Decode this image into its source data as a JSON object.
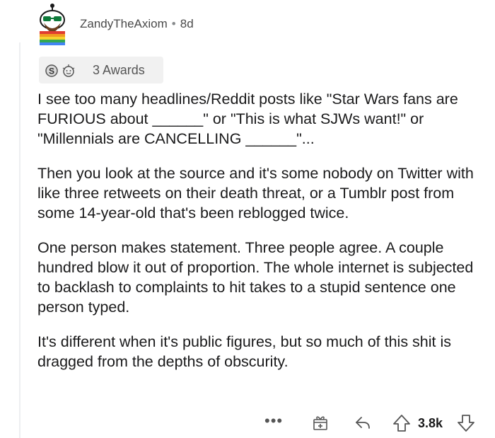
{
  "comment": {
    "author": "ZandyTheAxiom",
    "separator": "•",
    "age": "8d",
    "awards_label": "3 Awards",
    "award_icons": [
      "silver-award-icon",
      "wholesome-award-icon"
    ],
    "paragraphs": [
      "I see too many headlines/Reddit posts like \"Star Wars fans are FURIOUS about ______\" or \"This is what SJWs want!\" or \"Millennials are CANCELLING ______\"...",
      "Then you look at the source and it's some nobody on Twitter with like three retweets on their death threat, or a Tumblr post from some 14-year-old that's been reblogged twice.",
      "One person makes statement. Three people agree. A couple hundred blow it out of proportion. The whole internet is subjected to backlash to complaints to hit takes to a stupid sentence one person typed.",
      "It's different when it's public figures, but so much of this shit is dragged from the depths of obscurity."
    ],
    "actions": {
      "more": "•••",
      "score": "3.8k"
    }
  },
  "colors": {
    "meta_text": "#4a4a4a",
    "award_bg": "#f1f1f1",
    "thread_line": "#edeff1"
  }
}
